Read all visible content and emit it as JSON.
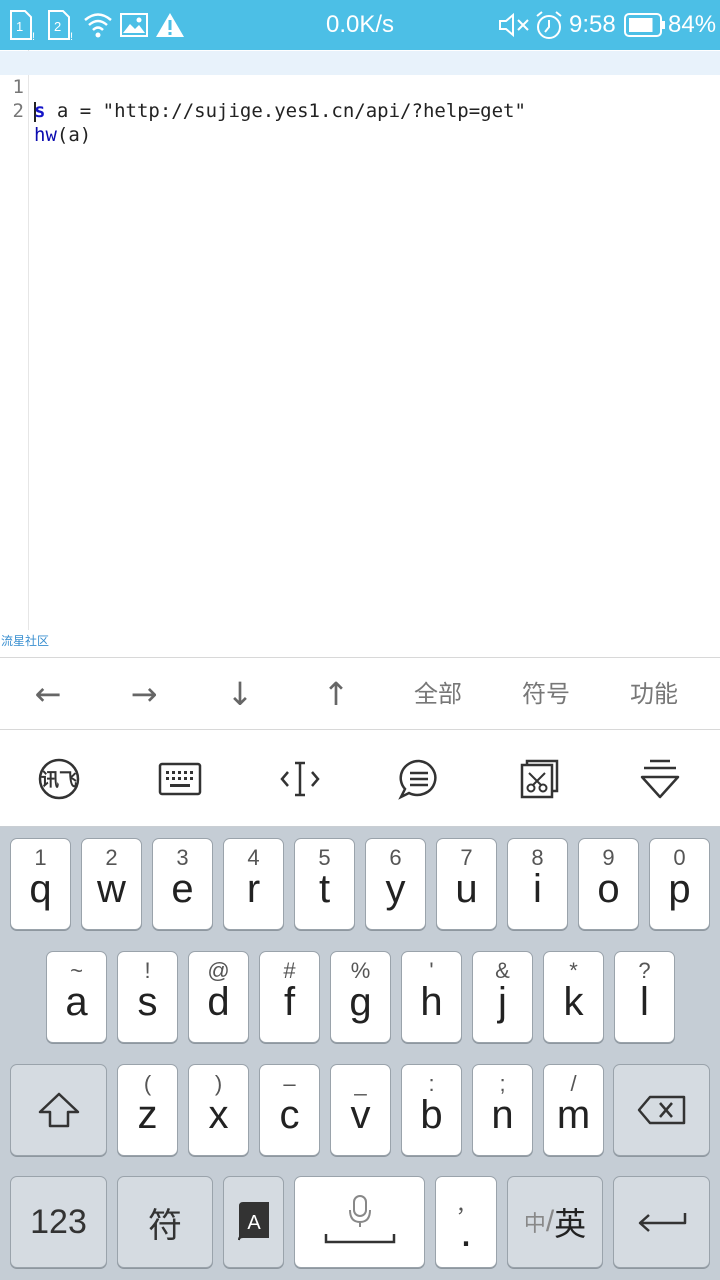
{
  "status_bar": {
    "sim1_label": "1",
    "sim2_label": "2",
    "speed": "0.0K/s",
    "time": "9:58",
    "battery_percent": "84%",
    "battery_level": 0.84,
    "background_color": "#4cbfe6"
  },
  "editor": {
    "lines": [
      {
        "number": "1",
        "keyword": "s",
        "rest": " a = \"http://sujige.yes1.cn/api/?help=get\""
      },
      {
        "number": "2",
        "keyword": "hw",
        "rest": "(a)"
      }
    ],
    "watermark": "流星社区"
  },
  "nav_toolbar": {
    "left": "←",
    "right": "→",
    "down": "↓",
    "up": "↑",
    "all": "全部",
    "symbols": "符号",
    "functions": "功能"
  },
  "ime_toolbar": {
    "icons": [
      "xunfei-logo-icon",
      "keyboard-icon",
      "cursor-move-icon",
      "chat-icon",
      "clipboard-cut-icon",
      "collapse-keyboard-icon"
    ]
  },
  "keyboard": {
    "row1": [
      {
        "sub": "1",
        "main": "q"
      },
      {
        "sub": "2",
        "main": "w"
      },
      {
        "sub": "3",
        "main": "e"
      },
      {
        "sub": "4",
        "main": "r"
      },
      {
        "sub": "5",
        "main": "t"
      },
      {
        "sub": "6",
        "main": "y"
      },
      {
        "sub": "7",
        "main": "u"
      },
      {
        "sub": "8",
        "main": "i"
      },
      {
        "sub": "9",
        "main": "o"
      },
      {
        "sub": "0",
        "main": "p"
      }
    ],
    "row2": [
      {
        "sub": "~",
        "main": "a"
      },
      {
        "sub": "!",
        "main": "s"
      },
      {
        "sub": "@",
        "main": "d"
      },
      {
        "sub": "#",
        "main": "f"
      },
      {
        "sub": "%",
        "main": "g"
      },
      {
        "sub": "'",
        "main": "h"
      },
      {
        "sub": "&",
        "main": "j"
      },
      {
        "sub": "*",
        "main": "k"
      },
      {
        "sub": "?",
        "main": "l"
      }
    ],
    "row3": [
      {
        "sub": "(",
        "main": "z"
      },
      {
        "sub": ")",
        "main": "x"
      },
      {
        "sub": "–",
        "main": "c"
      },
      {
        "sub": "_",
        "main": "v"
      },
      {
        "sub": ":",
        "main": "b"
      },
      {
        "sub": ";",
        "main": "n"
      },
      {
        "sub": "/",
        "main": "m"
      }
    ],
    "num_label": "123",
    "symbol_label": "符",
    "lang_inactive": "中",
    "lang_sep": "/",
    "lang_active": "英",
    "comma": "，",
    "period": "."
  }
}
